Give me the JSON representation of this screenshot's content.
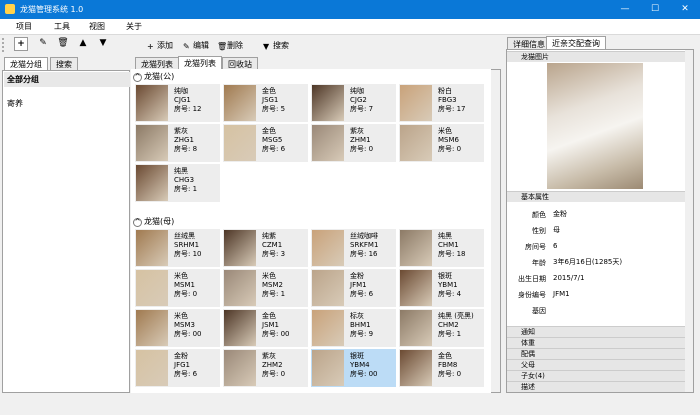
{
  "window": {
    "title": "龙猫管理系统 1.0",
    "minimize": "—",
    "maximize": "☐",
    "close": "✕"
  },
  "menu": [
    "项目",
    "工具",
    "视图",
    "关于"
  ],
  "left": {
    "tabs": [
      "龙猫分组",
      "搜索"
    ],
    "header": "全部分组",
    "items": [
      "寄养"
    ]
  },
  "center": {
    "toolbar": {
      "add": "添加",
      "edit": "编辑",
      "delete": "删除",
      "search": "搜索"
    },
    "tabs": [
      "龙猫列表",
      "龙猫列表",
      "回收站"
    ],
    "groups": [
      {
        "label": "龙猫(公)",
        "cards": [
          {
            "color": "纯咖",
            "code": "CJG1",
            "room": "房号: 12"
          },
          {
            "color": "金色",
            "code": "JSG1",
            "room": "房号: 5"
          },
          {
            "color": "纯咖",
            "code": "CJG2",
            "room": "房号: 7"
          },
          {
            "color": "粉白",
            "code": "FBG3",
            "room": "房号: 17"
          },
          {
            "color": "紫灰",
            "code": "ZHG1",
            "room": "房号: 8"
          },
          {
            "color": "金色",
            "code": "MSG5",
            "room": "房号: 6"
          },
          {
            "color": "紫灰",
            "code": "ZHM1",
            "room": "房号: 0"
          },
          {
            "color": "米色",
            "code": "MSM6",
            "room": "房号: 0"
          },
          {
            "color": "纯黑",
            "code": "CHG3",
            "room": "房号: 1"
          }
        ]
      },
      {
        "label": "龙猫(母)",
        "cards": [
          {
            "color": "丝绒黑",
            "code": "SRHM1",
            "room": "房号: 10"
          },
          {
            "color": "纯紫",
            "code": "CZM1",
            "room": "房号: 3"
          },
          {
            "color": "丝绒咖啡",
            "code": "SRKFM1",
            "room": "房号: 16"
          },
          {
            "color": "纯黑",
            "code": "CHM1",
            "room": "房号: 18"
          },
          {
            "color": "米色",
            "code": "MSM1",
            "room": "房号: 0"
          },
          {
            "color": "米色",
            "code": "MSM2",
            "room": "房号: 1"
          },
          {
            "color": "金粉",
            "code": "JFM1",
            "room": "房号: 6"
          },
          {
            "color": "银斑",
            "code": "YBM1",
            "room": "房号: 4"
          },
          {
            "color": "米色",
            "code": "MSM3",
            "room": "房号: 00"
          },
          {
            "color": "金色",
            "code": "JSM1",
            "room": "房号: 00"
          },
          {
            "color": "标灰",
            "code": "BHM1",
            "room": "房号: 9"
          },
          {
            "color": "纯黑 (亮黑)",
            "code": "CHM2",
            "room": "房号: 1"
          },
          {
            "color": "金粉",
            "code": "JFG1",
            "room": "房号: 6"
          },
          {
            "color": "紫灰",
            "code": "ZHM2",
            "room": "房号: 0"
          },
          {
            "color": "银斑",
            "code": "YBM4",
            "room": "房号: 00"
          },
          {
            "color": "金色",
            "code": "FBM8",
            "room": "房号: 0"
          }
        ]
      }
    ]
  },
  "right": {
    "tabs": [
      "详细信息",
      "近亲交配查询"
    ],
    "photo_section": "龙猫图片",
    "basic_section": "基本属性",
    "props": [
      {
        "label": "颜色",
        "value": "金粉"
      },
      {
        "label": "性别",
        "value": "母"
      },
      {
        "label": "房间号",
        "value": "6"
      },
      {
        "label": "年龄",
        "value": "3年6月16日(1285天)"
      },
      {
        "label": "出生日期",
        "value": "2015/7/1"
      },
      {
        "label": "身份编号",
        "value": "JFM1"
      },
      {
        "label": "基因",
        "value": ""
      }
    ],
    "sections": [
      "通知",
      "体重",
      "配偶",
      "父母",
      "子女(4)",
      "描述"
    ]
  }
}
